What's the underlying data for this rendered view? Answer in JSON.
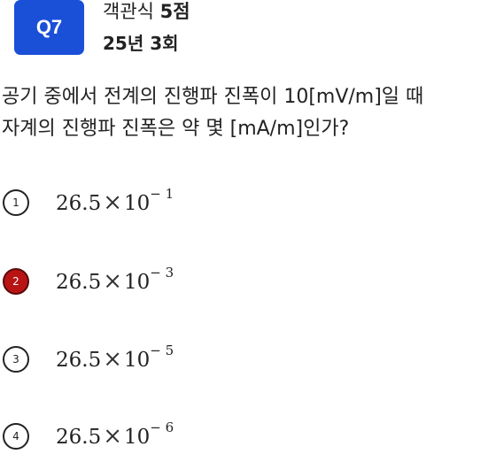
{
  "header": {
    "badge": "Q7",
    "type_label": "객관식",
    "score": "5점",
    "round": "25년 3회"
  },
  "question": {
    "line1": "공기 중에서 전계의 진행파 진폭이 10[mV/m]일 때",
    "line2": "자계의 진행파 진폭은 약 몇 [mA/m]인가?"
  },
  "options": [
    {
      "number": "1",
      "mantissa": "26.5",
      "times": "×",
      "base": "10",
      "exponent": "− 1",
      "selected": false
    },
    {
      "number": "2",
      "mantissa": "26.5",
      "times": "×",
      "base": "10",
      "exponent": "− 3",
      "selected": true
    },
    {
      "number": "3",
      "mantissa": "26.5",
      "times": "×",
      "base": "10",
      "exponent": "− 5",
      "selected": false
    },
    {
      "number": "4",
      "mantissa": "26.5",
      "times": "×",
      "base": "10",
      "exponent": "− 6",
      "selected": false
    }
  ],
  "colors": {
    "badge": "#1a4fd8",
    "selected": "#b81414"
  }
}
